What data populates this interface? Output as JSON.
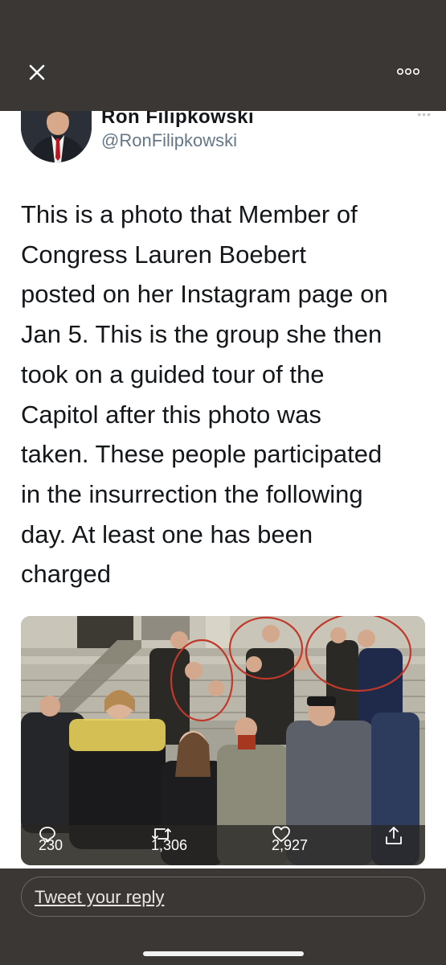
{
  "tweet": {
    "author_name": "Ron Filipkowski",
    "handle": "@RonFilipkowski",
    "text": "This is a photo that Member of\nCongress Lauren Boebert\nposted on her Instagram page on\nJan 5. This is the group she then\ntook on a guided tour of the\nCapitol after this photo was\ntaken. These people participated\nin the insurrection the following\nday. At least one has been\ncharged"
  },
  "stats": {
    "replies": "230",
    "retweets": "1,306",
    "likes": "2,927"
  },
  "reply": {
    "placeholder": "Tweet your reply"
  },
  "icons": {
    "close": "close-icon",
    "more": "more-icon",
    "reply": "reply-icon",
    "retweet": "retweet-icon",
    "like": "like-icon",
    "share": "share-icon"
  },
  "colors": {
    "chrome_background": "#3a3734",
    "sheet_background": "#ffffff",
    "text_primary": "#14171a",
    "text_secondary": "#657786"
  }
}
